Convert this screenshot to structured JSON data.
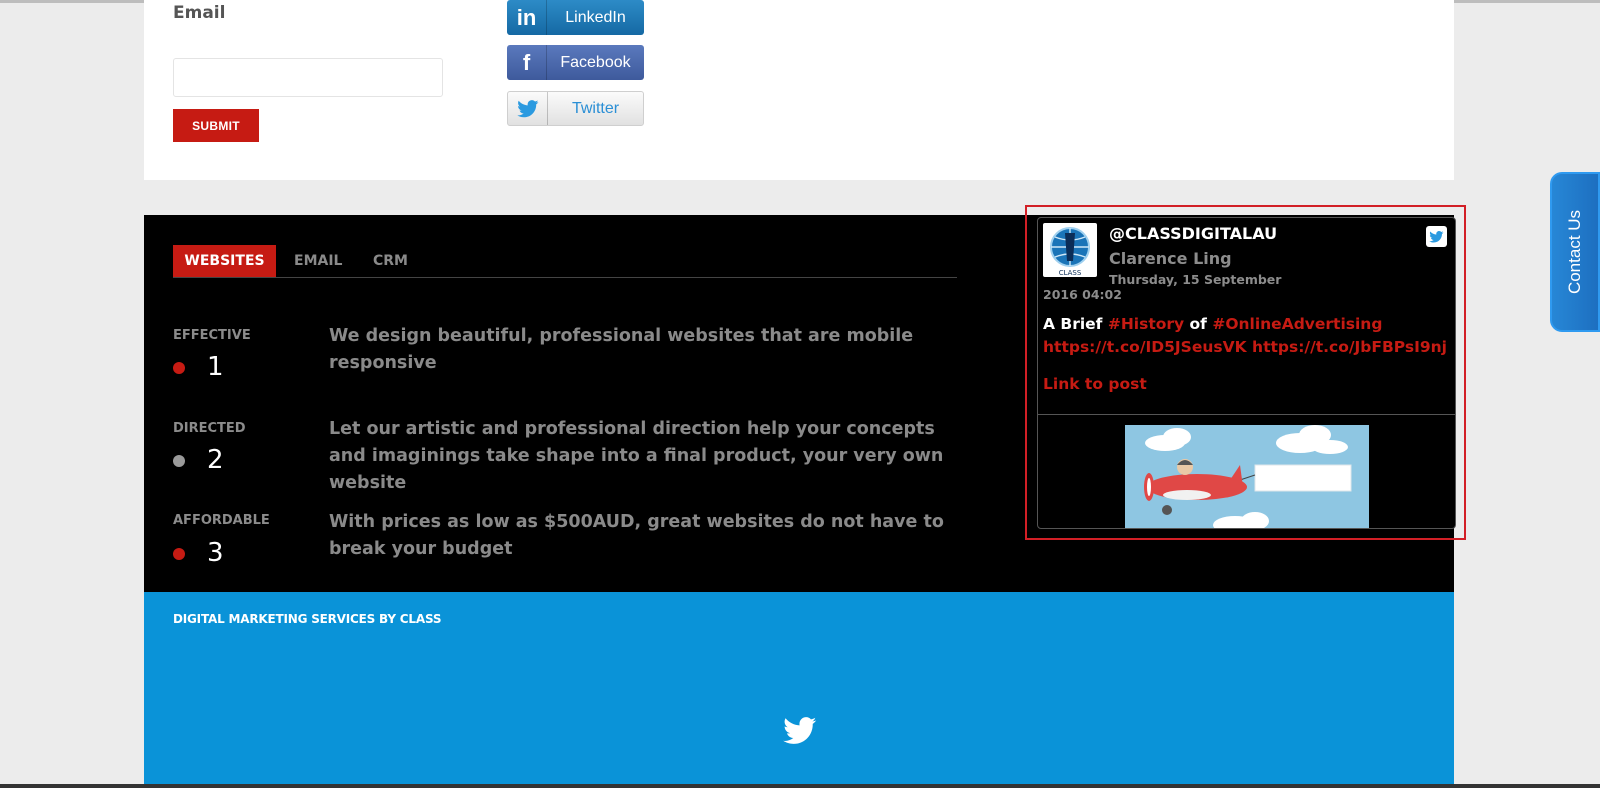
{
  "form": {
    "email_label": "Email",
    "email_value": "",
    "email_placeholder": "",
    "submit_label": "SUBMIT"
  },
  "social": {
    "linkedin": {
      "icon": "in",
      "label": "LinkedIn"
    },
    "facebook": {
      "icon": "f",
      "label": "Facebook"
    },
    "twitter": {
      "label": "Twitter"
    }
  },
  "tabs": [
    {
      "label": "WEBSITES",
      "active": true
    },
    {
      "label": "EMAIL",
      "active": false
    },
    {
      "label": "CRM",
      "active": false
    }
  ],
  "features": [
    {
      "label": "EFFECTIVE",
      "number": "1",
      "dot_color": "#c61b13",
      "text": "We design beautiful, professional websites that are mobile responsive"
    },
    {
      "label": "DIRECTED",
      "number": "2",
      "dot_color": "#9a9a9a",
      "text": "Let our artistic and professional direction help your concepts and imaginings take shape into a final product, your very own website"
    },
    {
      "label": "AFFORDABLE",
      "number": "3",
      "dot_color": "#c61b13",
      "text": "With prices as low as $500AUD, great websites do not have to break your budget"
    }
  ],
  "tweet": {
    "handle": "@CLASSDIGITALAU",
    "name": "Clarence Ling",
    "date_line1": "Thursday, 15 September",
    "date_line2": "2016 04:02",
    "text_a": "A Brief ",
    "hashtag1": "#History",
    "text_b": " of ",
    "hashtag2": "#OnlineAdvertising",
    "url1": "https://t.co/ID5JSeusVK",
    "url2": "https://t.co/JbFBPsI9nj",
    "link_to_post": "Link to post",
    "avatar_caption": "CLASS"
  },
  "footer": {
    "title": "DIGITAL MARKETING SERVICES BY CLASS"
  },
  "contact_tab": {
    "label": "Contact Us"
  },
  "colors": {
    "accent_red": "#c61b13",
    "footer_blue": "#0a93d8",
    "contact_blue": "#1d6fc0"
  }
}
